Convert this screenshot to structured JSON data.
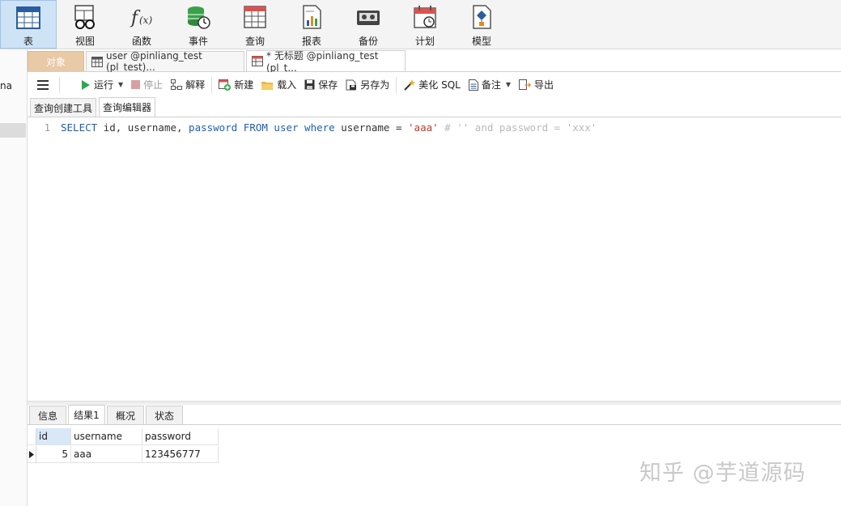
{
  "ribbon": {
    "items": [
      {
        "label": "表",
        "icon": "table-icon"
      },
      {
        "label": "视图",
        "icon": "view-icon"
      },
      {
        "label": "函数",
        "icon": "function-icon"
      },
      {
        "label": "事件",
        "icon": "event-icon"
      },
      {
        "label": "查询",
        "icon": "query-icon"
      },
      {
        "label": "报表",
        "icon": "report-icon"
      },
      {
        "label": "备份",
        "icon": "backup-icon"
      },
      {
        "label": "计划",
        "icon": "schedule-icon"
      },
      {
        "label": "模型",
        "icon": "model-icon"
      }
    ]
  },
  "left_panel": {
    "partial_text": "na"
  },
  "doc_tabs": {
    "objects": "对象",
    "tab1": "user @pinliang_test (pl_test)...",
    "tab2": "* 无标题 @pinliang_test (pl_t..."
  },
  "toolbar": {
    "run": "运行",
    "stop": "停止",
    "explain": "解释",
    "new": "新建",
    "load": "载入",
    "save": "保存",
    "save_as": "另存为",
    "beautify": "美化 SQL",
    "comment": "备注",
    "export": "导出"
  },
  "sub_tabs": {
    "builder": "查询创建工具",
    "editor": "查询编辑器"
  },
  "editor": {
    "line_number": "1",
    "tokens": {
      "select": "SELECT",
      "cols_a": " id, username, ",
      "password": "password",
      "from": " FROM ",
      "user": "user",
      "where": " where ",
      "username2": "username = ",
      "str_aaa": "'aaa'",
      "comment": " # '' and password = 'xxx'"
    }
  },
  "result_tabs": {
    "info": "信息",
    "result1": "结果1",
    "overview": "概况",
    "status": "状态"
  },
  "result_grid": {
    "columns": [
      "id",
      "username",
      "password"
    ],
    "rows": [
      [
        "5",
        "aaa",
        "123456777"
      ]
    ]
  },
  "watermark": "知乎 @芋道源码"
}
